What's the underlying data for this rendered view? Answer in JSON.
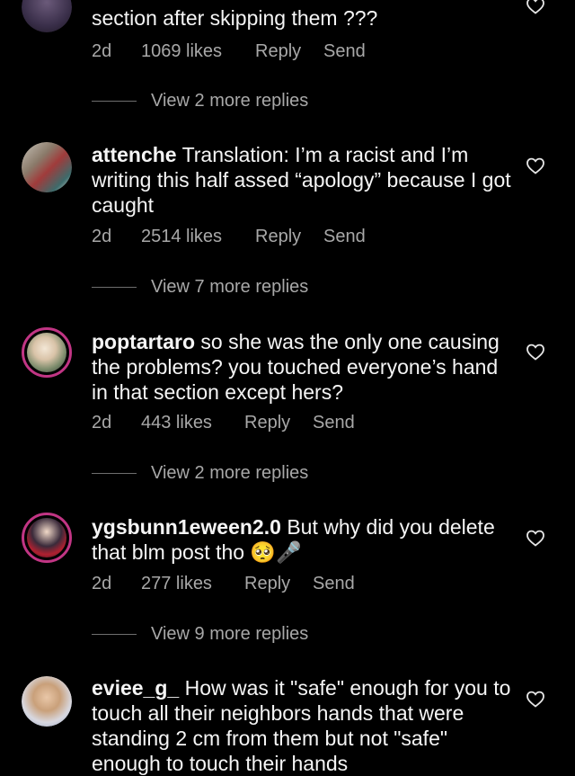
{
  "comments": [
    {
      "username": "",
      "text": "section after skipping them ???",
      "time": "2d",
      "likes": "1069 likes",
      "reply": "Reply",
      "send": "Send",
      "view_more": "View 2 more replies"
    },
    {
      "username": "attenche",
      "text": "Translation: I’m a racist and I’m writing this half assed “apology” because I got caught",
      "time": "2d",
      "likes": "2514 likes",
      "reply": "Reply",
      "send": "Send",
      "view_more": "View 7 more replies"
    },
    {
      "username": "poptartaro",
      "text": "so she was the only one causing the problems? you touched everyone’s hand in that section except hers?",
      "time": "2d",
      "likes": "443 likes",
      "reply": "Reply",
      "send": "Send",
      "view_more": "View 2 more replies"
    },
    {
      "username": "ygsbunn1eween2.0",
      "text": "But why did you delete that blm post tho 🥺🎤",
      "time": "2d",
      "likes": "277 likes",
      "reply": "Reply",
      "send": "Send",
      "view_more": "View 9 more replies"
    },
    {
      "username": "eviee_g_",
      "text": "How was it \"safe\" enough for you to touch all their neighbors hands that were standing 2 cm from them but not \"safe\" enough to touch their hands",
      "time": "",
      "likes": "",
      "reply": "",
      "send": "",
      "view_more": ""
    }
  ],
  "colors": {
    "background": "#000000",
    "text": "#f5f5f5",
    "secondary_text": "#a8a8a8",
    "story_ring": "#c13584"
  },
  "icons": [
    "heart-icon"
  ]
}
